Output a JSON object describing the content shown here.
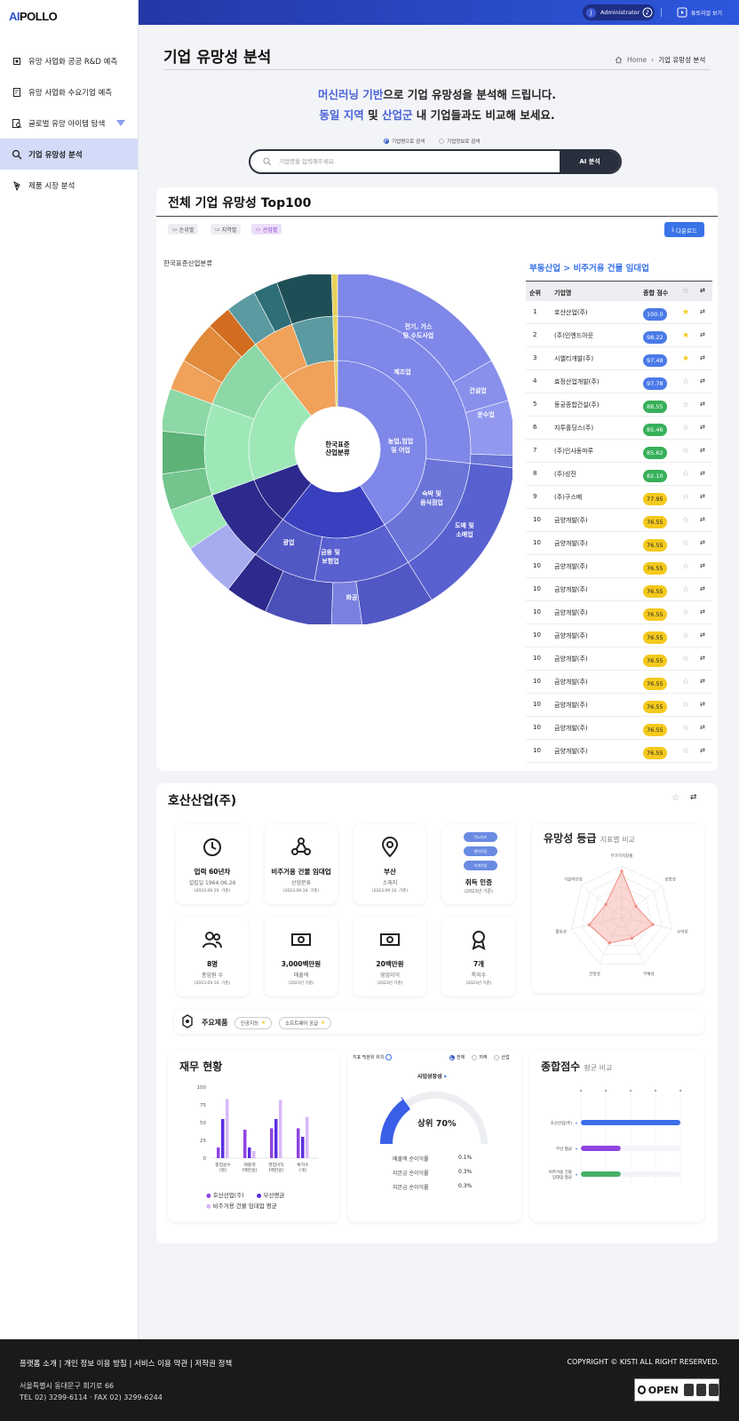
{
  "brand": {
    "ai": "AI",
    "rest": "POLLO"
  },
  "sidebar": {
    "items": [
      {
        "label": "유망 사업화 공공 R&D 예측",
        "icon": "chip-icon"
      },
      {
        "label": "유망 사업화 수요기업 예측",
        "icon": "building-icon"
      },
      {
        "label": "글로벌 유망 아이템 탐색",
        "icon": "doc-search-icon"
      },
      {
        "label": "기업 유망성 분석",
        "icon": "search-icon"
      },
      {
        "label": "제품 시장 분석",
        "icon": "product-icon"
      }
    ]
  },
  "topbar": {
    "user_initial": "J",
    "user": "Administrator",
    "tutorial": "튜토리얼 보기"
  },
  "page": {
    "title": "기업 유망성 분석",
    "crumb_home": "Home",
    "crumb_current": "기업 유망성 분석"
  },
  "hero": {
    "l1a": "머신러닝 기반",
    "l1b": "으로 기업 유망성을 분석해 드립니다.",
    "l2a": "동일 지역",
    "l2b": " 및 ",
    "l2c": "산업군",
    "l2d": " 내 기업들과도 비교해 보세요."
  },
  "search": {
    "opt1": "기업명으로 검색",
    "opt2": "기업정보로 검색",
    "placeholder": "기업명을 입력해주세요.",
    "button": "AI 분석"
  },
  "top100": {
    "title": "전체 기업 유망성 Top100",
    "filters": [
      "순위별",
      "지역별",
      "산업별"
    ],
    "download": "다운로드",
    "chart_label": "한국표준산업분류",
    "category": "부동산업 > 비주거용 건물 임대업",
    "col_rank": "순위",
    "col_name": "기업명",
    "col_score": "종합 점수",
    "rows": [
      {
        "rank": "1",
        "name": "호산산업(주)",
        "score": "100.0",
        "c": "b-blue",
        "star": true
      },
      {
        "rank": "2",
        "name": "(주)인엔드아웃",
        "score": "98.22",
        "c": "b-blue",
        "star": true
      },
      {
        "rank": "3",
        "name": "시엘티개발(주)",
        "score": "97.48",
        "c": "b-blue",
        "star": true
      },
      {
        "rank": "4",
        "name": "효정산업개발(주)",
        "score": "97.78",
        "c": "b-blue",
        "star": false
      },
      {
        "rank": "5",
        "name": "동궁종합건설(주)",
        "score": "88.55",
        "c": "b-green",
        "star": false
      },
      {
        "rank": "6",
        "name": "지투홀딩스(주)",
        "score": "85.46",
        "c": "b-green",
        "star": false
      },
      {
        "rank": "7",
        "name": "(주)인사동마루",
        "score": "85.62",
        "c": "b-green",
        "star": false
      },
      {
        "rank": "8",
        "name": "(주)성진",
        "score": "82.10",
        "c": "b-green",
        "star": false
      },
      {
        "rank": "9",
        "name": "(주)구스베",
        "score": "77.95",
        "c": "b-yel",
        "star": false
      },
      {
        "rank": "10",
        "name": "금양개발(주)",
        "score": "76.55",
        "c": "b-yel",
        "star": false
      },
      {
        "rank": "10",
        "name": "금양개발(주)",
        "score": "76.55",
        "c": "b-yel",
        "star": false
      },
      {
        "rank": "10",
        "name": "금양개발(주)",
        "score": "76.55",
        "c": "b-yel",
        "star": false
      },
      {
        "rank": "10",
        "name": "금양개발(주)",
        "score": "76.55",
        "c": "b-yel",
        "star": false
      },
      {
        "rank": "10",
        "name": "금양개발(주)",
        "score": "76.55",
        "c": "b-yel",
        "star": false
      },
      {
        "rank": "10",
        "name": "금양개발(주)",
        "score": "76.55",
        "c": "b-yel",
        "star": false
      },
      {
        "rank": "10",
        "name": "금양개발(주)",
        "score": "76.55",
        "c": "b-yel",
        "star": false
      },
      {
        "rank": "10",
        "name": "금양개발(주)",
        "score": "76.55",
        "c": "b-yel",
        "star": false
      },
      {
        "rank": "10",
        "name": "금양개발(주)",
        "score": "76.55",
        "c": "b-yel",
        "star": false
      },
      {
        "rank": "10",
        "name": "금양개발(주)",
        "score": "76.55",
        "c": "b-yel",
        "star": false
      },
      {
        "rank": "10",
        "name": "금양개발(주)",
        "score": "76.55",
        "c": "b-yel",
        "star": false
      }
    ],
    "sunburst": {
      "center1": "한국표준",
      "center2": "산업분류",
      "labels": [
        "전기, 가스",
        "및 수도사업",
        "제조업",
        "건설업",
        "운수업",
        "농업,임업",
        "및 어업",
        "숙박 및",
        "음식점업",
        "도매 및",
        "소매업",
        "금융 및",
        "보험업",
        "광업",
        "화공"
      ]
    }
  },
  "company": {
    "name": "호산산업(주)",
    "cards": [
      {
        "big": "업력 60년차",
        "sub": "설립일 1964.06.26",
        "tiny": "(2023.09.10. 기준)",
        "icon": "history-icon"
      },
      {
        "big": "비주거용 건물 임대업",
        "sub": "산업분류",
        "tiny": "(2023.09.10. 기준)",
        "icon": "network-icon"
      },
      {
        "big": "부산",
        "sub": "소재지",
        "tiny": "(2023.09.10. 기준)",
        "icon": "location-icon"
      },
      {
        "big": "취득 인증",
        "sub": "(2023년 기준)",
        "tiny": "",
        "icon": "cert-icon"
      },
      {
        "big": "8명",
        "sub": "종업원 수",
        "tiny": "(2023.09.10. 기준)",
        "icon": "people-icon"
      },
      {
        "big": "3,000백만원",
        "sub": "매출액",
        "tiny": "(2023년 기준)",
        "icon": "money-icon"
      },
      {
        "big": "20백만원",
        "sub": "영업이익",
        "tiny": "(2023년 기준)",
        "icon": "money-icon"
      },
      {
        "big": "7개",
        "sub": "특허수",
        "tiny": "(2023년 기준)",
        "icon": "award-icon"
      }
    ],
    "certs": [
      "이노비즈",
      "벤처기업",
      "녹색기업"
    ],
    "products_label": "주요제품",
    "products": [
      "인공지능",
      "소프트웨어 공급"
    ]
  },
  "radar": {
    "title": "유망성 등급",
    "subtitle": "지표별 비교",
    "axes": [
      "부가가치창출",
      "성장성",
      "수익성",
      "부채성",
      "안정성",
      "활동성",
      "기술혁신성"
    ],
    "values": [
      0.9,
      0.35,
      0.62,
      0.45,
      0.55,
      0.65,
      0.4
    ]
  },
  "finance": {
    "title": "재무 현황",
    "ticks": [
      "100",
      "75",
      "50",
      "25",
      "0"
    ],
    "cats": [
      "종업원수\n(명)",
      "매출액\n(백만원)",
      "영업이익\n(백만원)",
      "특허수\n(개)"
    ],
    "series": [
      {
        "name": "호산산업(주)",
        "color": "#8e44e0",
        "values": [
          15,
          40,
          42,
          42
        ]
      },
      {
        "name": "부산평균",
        "color": "#5b2ee0",
        "values": [
          55,
          15,
          55,
          30
        ]
      },
      {
        "name": "비주거용 건물 임대업 평균",
        "color": "#d8b8f6",
        "values": [
          83,
          10,
          82,
          58
        ]
      }
    ]
  },
  "growth": {
    "label": "지표 백분위 위치",
    "opts": [
      "전체",
      "지역",
      "산업"
    ],
    "select": "사업성장성",
    "pct": "상위 70%",
    "value": 0.3,
    "rows": [
      {
        "k": "매출액 순이익률",
        "v": "0.1%"
      },
      {
        "k": "자본금 순이익률",
        "v": "0.3%"
      },
      {
        "k": "자본금 순이익률",
        "v": "0.3%"
      }
    ]
  },
  "total": {
    "title": "종합점수",
    "subtitle": "평균 비교",
    "rows": [
      {
        "k": "호산산업(주)",
        "color": "#3a6fe8",
        "value": 1.0
      },
      {
        "k": "부산 평균",
        "color": "#8e44e0",
        "value": 0.4
      },
      {
        "k": "비주거용 건물\n임대업 평균",
        "color": "#45b066",
        "value": 0.4
      }
    ]
  },
  "footer": {
    "links": "플랫폼 소개 | 개인 정보 이용 방침 | 서비스 이용 약관 | 저작권 정책",
    "addr": "서울특별시 동대문구 회기로 66",
    "tel": "TEL 02) 3299-6114 · FAX 02) 3299-6244",
    "copy": "COPYRIGHT © KISTI ALL RIGHT RESERVED.",
    "open": "OPEN"
  }
}
